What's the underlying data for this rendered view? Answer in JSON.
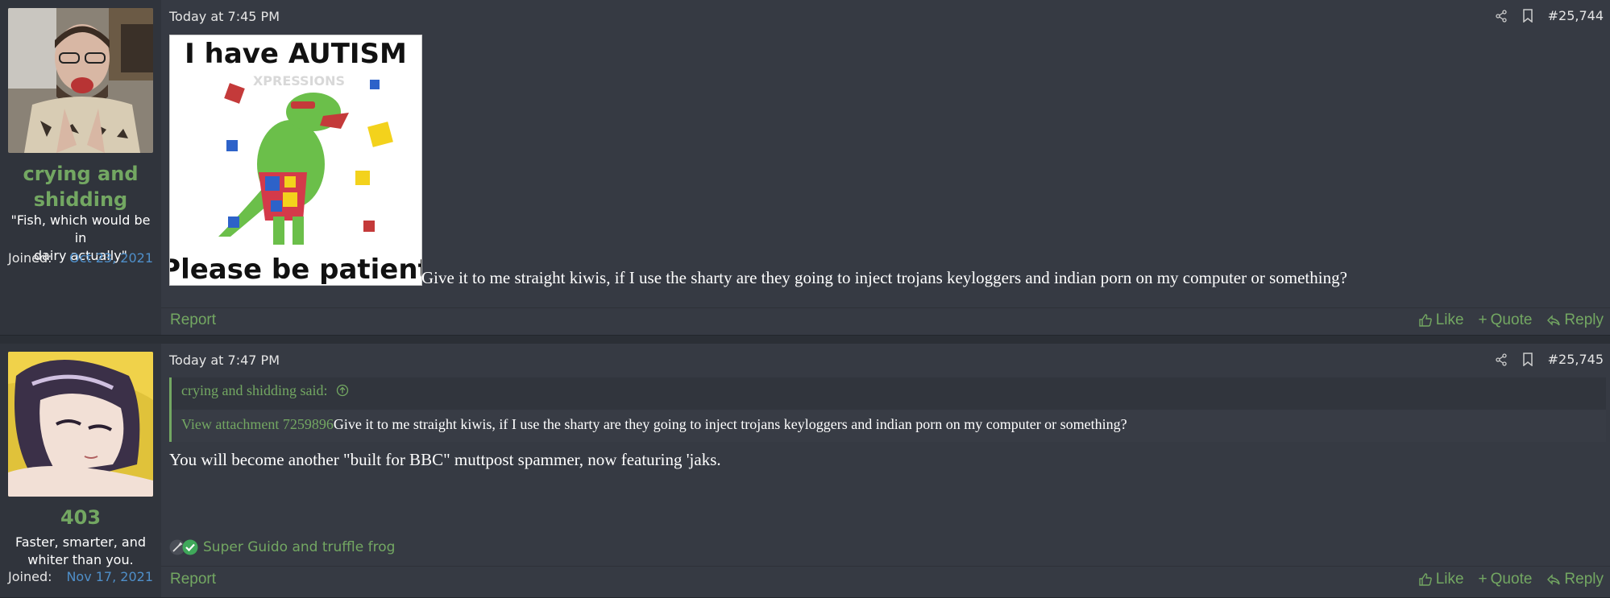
{
  "posts": [
    {
      "username": "crying and shidding",
      "username_line1": "crying and",
      "username_line2": "shidding",
      "user_title_line1": "\"Fish, which would be in",
      "user_title_line2": "dairy actually\"",
      "joined_label": "Joined:",
      "joined_date": "Oct 23, 2021",
      "date": "Today at 7:45 PM",
      "post_number": "#25,744",
      "image_top_text": "I have AUTISM",
      "image_bottom_text": "Please be patient",
      "image_watermark": "XPRESSIONS",
      "body": "Give it to me straight kiwis, if I use the sharty are they going to inject trojans keyloggers and indian porn on my computer or something?",
      "report_label": "Report",
      "like_label": "Like",
      "quote_label": "Quote",
      "reply_label": "Reply"
    },
    {
      "username": "403",
      "user_title_line1": "Faster, smarter, and",
      "user_title_line2": "whiter than you.",
      "joined_label": "Joined:",
      "joined_date": "Nov 17, 2021",
      "date": "Today at 7:47 PM",
      "post_number": "#25,745",
      "quote_author": "crying and shidding said:",
      "quote_attachment": "View attachment 7259896",
      "quote_text": "Give it to me straight kiwis, if I use the sharty are they going to inject trojans keyloggers and indian porn on my computer or something?",
      "body": "You will become another \"built for BBC\" muttpost spammer, now featuring 'jaks.",
      "reactions": "Super Guido and truffle frog",
      "report_label": "Report",
      "like_label": "Like",
      "quote_label": "Quote",
      "reply_label": "Reply"
    }
  ],
  "colors": {
    "accent": "#73a762",
    "link_blue": "#4f8fc9",
    "post_bg": "#363a43",
    "user_col_bg": "#30343c"
  },
  "icons": [
    "share-icon",
    "bookmark-icon",
    "like-icon",
    "quote-plus-icon",
    "reply-icon",
    "arrow-up-circle-icon",
    "wrench-icon",
    "check-icon"
  ]
}
